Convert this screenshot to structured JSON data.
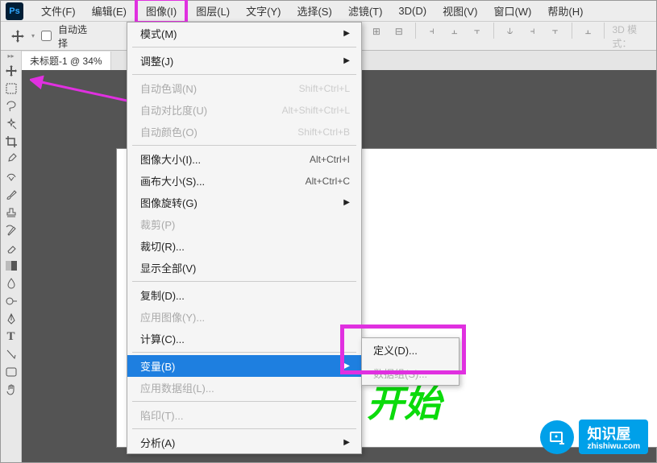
{
  "app": {
    "logo": "Ps"
  },
  "menubar": {
    "items": [
      "文件(F)",
      "编辑(E)",
      "图像(I)",
      "图层(L)",
      "文字(Y)",
      "选择(S)",
      "滤镜(T)",
      "3D(D)",
      "视图(V)",
      "窗口(W)",
      "帮助(H)"
    ],
    "highlighted_index": 2
  },
  "optbar": {
    "auto_select": "自动选择",
    "mode_3d": "3D 模式："
  },
  "doc_tab": "未标题-1 @ 34% ",
  "image_menu": {
    "groups": [
      [
        {
          "label": "模式(M)",
          "arrow": true
        }
      ],
      [
        {
          "label": "调整(J)",
          "arrow": true
        }
      ],
      [
        {
          "label": "自动色调(N)",
          "shortcut": "Shift+Ctrl+L",
          "disabled": true
        },
        {
          "label": "自动对比度(U)",
          "shortcut": "Alt+Shift+Ctrl+L",
          "disabled": true
        },
        {
          "label": "自动颜色(O)",
          "shortcut": "Shift+Ctrl+B",
          "disabled": true
        }
      ],
      [
        {
          "label": "图像大小(I)...",
          "shortcut": "Alt+Ctrl+I"
        },
        {
          "label": "画布大小(S)...",
          "shortcut": "Alt+Ctrl+C"
        },
        {
          "label": "图像旋转(G)",
          "arrow": true
        },
        {
          "label": "裁剪(P)",
          "disabled": true
        },
        {
          "label": "裁切(R)..."
        },
        {
          "label": "显示全部(V)"
        }
      ],
      [
        {
          "label": "复制(D)..."
        },
        {
          "label": "应用图像(Y)...",
          "disabled": true
        },
        {
          "label": "计算(C)..."
        }
      ],
      [
        {
          "label": "变量(B)",
          "arrow": true,
          "selected": true
        },
        {
          "label": "应用数据组(L)...",
          "disabled": true
        }
      ],
      [
        {
          "label": "陷印(T)...",
          "disabled": true
        }
      ],
      [
        {
          "label": "分析(A)",
          "arrow": true
        }
      ]
    ]
  },
  "submenu": {
    "items": [
      {
        "label": "定义(D)..."
      },
      {
        "label": "数据组(S)...",
        "disabled": true
      }
    ]
  },
  "canvas_text": "开始",
  "watermark": {
    "brand": "知识屋",
    "url": "zhishiwu.com"
  }
}
